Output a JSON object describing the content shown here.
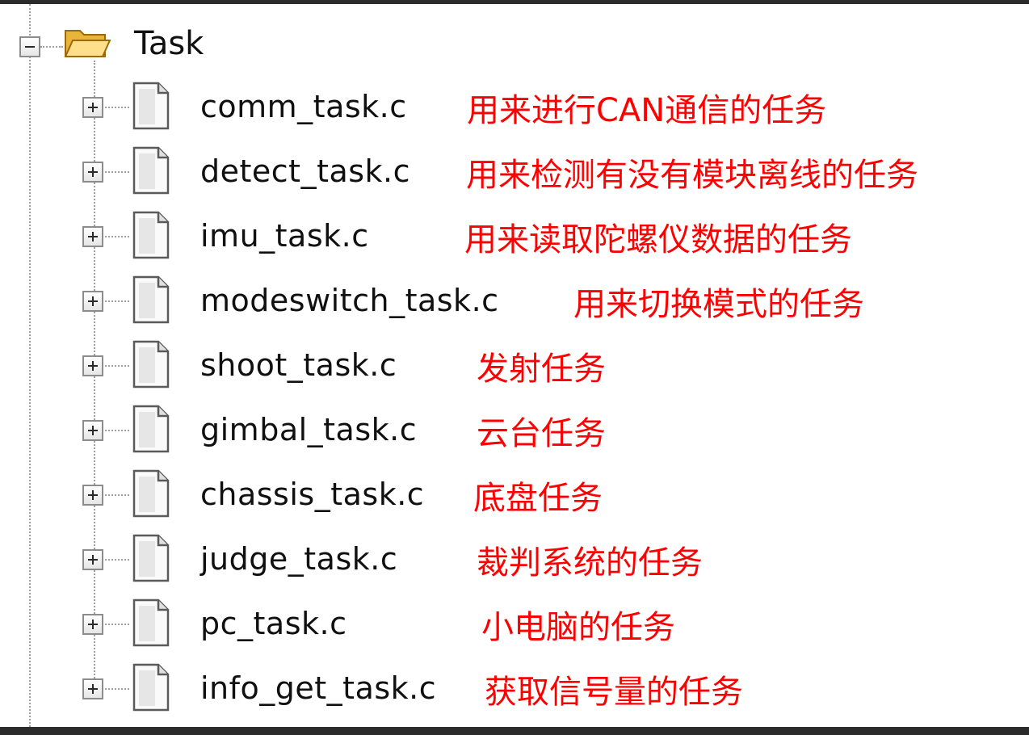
{
  "tree": {
    "root": {
      "label": "Task",
      "expander": "minus",
      "icon": "folder-open-icon"
    },
    "items": [
      {
        "file": "comm_task.c",
        "note": "用来进行CAN通信的任务",
        "expander": "plus",
        "icon": "file-icon"
      },
      {
        "file": "detect_task.c",
        "note": "用来检测有没有模块离线的任务",
        "expander": "plus",
        "icon": "file-icon"
      },
      {
        "file": "imu_task.c",
        "note": "用来读取陀螺仪数据的任务",
        "expander": "plus",
        "icon": "file-icon"
      },
      {
        "file": "modeswitch_task.c",
        "note": "用来切换模式的任务",
        "expander": "plus",
        "icon": "file-icon"
      },
      {
        "file": "shoot_task.c",
        "note": "发射任务",
        "expander": "plus",
        "icon": "file-icon"
      },
      {
        "file": "gimbal_task.c",
        "note": "云台任务",
        "expander": "plus",
        "icon": "file-icon"
      },
      {
        "file": "chassis_task.c",
        "note": "底盘任务",
        "expander": "plus",
        "icon": "file-icon"
      },
      {
        "file": "judge_task.c",
        "note": "裁判系统的任务",
        "expander": "plus",
        "icon": "file-icon"
      },
      {
        "file": "pc_task.c",
        "note": "小电脑的任务",
        "expander": "plus",
        "icon": "file-icon"
      },
      {
        "file": "info_get_task.c",
        "note": "获取信号量的任务",
        "expander": "plus",
        "icon": "file-icon"
      }
    ]
  },
  "colors": {
    "annotation": "#ff0000",
    "text": "#101010",
    "tree_lines": "#a0a0a0",
    "frame": "#2b2b2b"
  }
}
